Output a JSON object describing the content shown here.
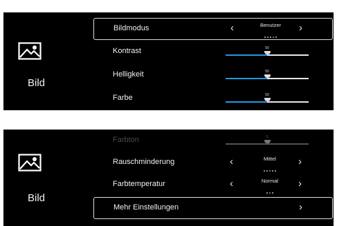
{
  "panel1": {
    "section_icon": "image-icon",
    "section_label": "Bild",
    "rows": [
      {
        "label": "Bildmodus",
        "value": "Benutzer",
        "arrow_left": "‹",
        "arrow_right": "›"
      },
      {
        "label": "Kontrast",
        "slider_value": "50",
        "level": 0.5
      },
      {
        "label": "Helligkeit",
        "slider_value": "50",
        "level": 0.5
      },
      {
        "label": "Farbe",
        "slider_value": "50",
        "level": 0.5
      }
    ]
  },
  "panel2": {
    "section_icon": "image-icon",
    "section_label": "Bild",
    "rows": [
      {
        "label": "Farbton",
        "slider_value": "0",
        "level": 0.5
      },
      {
        "label": "Rauschminderung",
        "value": "Mittel",
        "arrow_left": "‹",
        "arrow_right": "›"
      },
      {
        "label": "Farbtemperatur",
        "value": "Normal",
        "arrow_left": "‹",
        "arrow_right": "›"
      },
      {
        "label": "Mehr Einstellungen",
        "arrow_right": "›"
      }
    ]
  },
  "colors": {
    "accent": "#1f9be0",
    "background": "#000000"
  }
}
